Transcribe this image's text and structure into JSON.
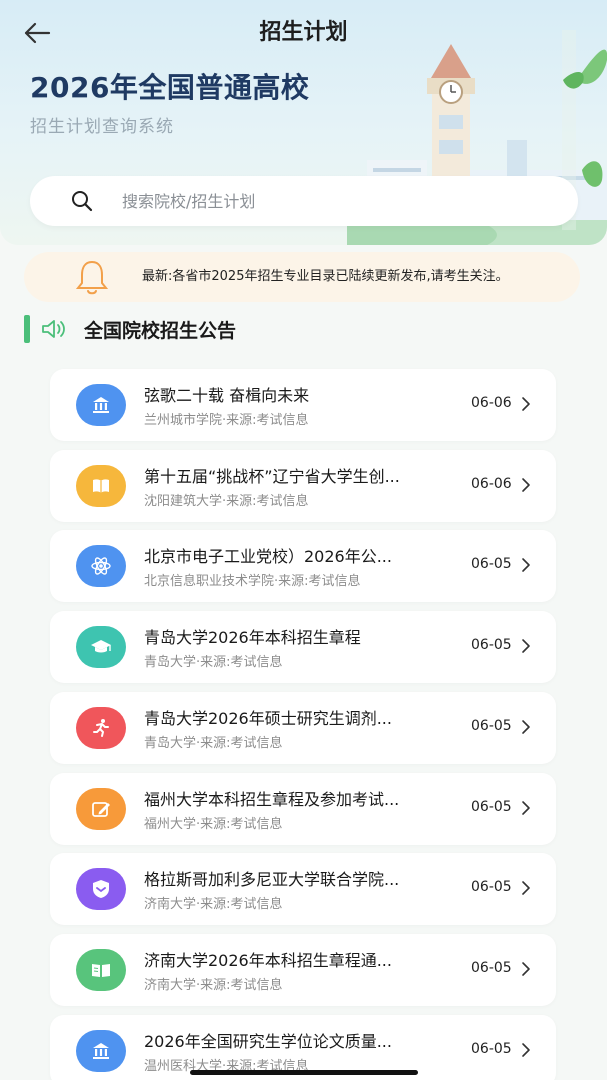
{
  "header": {
    "title": "招生计划",
    "hero_title": "2026年全国普通高校",
    "hero_subtitle": "招生计划查询系统"
  },
  "search": {
    "placeholder": "搜索院校/招生计划"
  },
  "notice": {
    "text": "最新:各省市2025年招生专业目录已陆续更新发布,请考生关注。"
  },
  "section": {
    "title": "全国院校招生公告"
  },
  "colors": {
    "accent_green": "#4bbf7a",
    "icon_blue": "#4f93f0",
    "icon_yellow": "#f6b73c",
    "icon_teal": "#3ec4b0",
    "icon_red": "#f0565b",
    "icon_orange": "#f79a3a",
    "icon_purple": "#8a5cf0",
    "icon_green": "#58c47c"
  },
  "announcements": [
    {
      "title": "弦歌二十载 奋楫向未来",
      "meta": "兰州城市学院·来源:考试信息",
      "date": "06-06",
      "icon": "institution-icon",
      "color": "#4f93f0"
    },
    {
      "title": "第十五届“挑战杯”辽宁省大学生创...",
      "meta": "沈阳建筑大学·来源:考试信息",
      "date": "06-06",
      "icon": "book-icon",
      "color": "#f6b73c"
    },
    {
      "title": "北京市电子工业党校）2026年公...",
      "meta": "北京信息职业技术学院·来源:考试信息",
      "date": "06-05",
      "icon": "atom-icon",
      "color": "#4f93f0"
    },
    {
      "title": "青岛大学2026年本科招生章程",
      "meta": "青岛大学·来源:考试信息",
      "date": "06-05",
      "icon": "graduation-cap-icon",
      "color": "#3ec4b0"
    },
    {
      "title": "青岛大学2026年硕士研究生调剂...",
      "meta": "青岛大学·来源:考试信息",
      "date": "06-05",
      "icon": "runner-icon",
      "color": "#f0565b"
    },
    {
      "title": "福州大学本科招生章程及参加考试...",
      "meta": "福州大学·来源:考试信息",
      "date": "06-05",
      "icon": "edit-icon",
      "color": "#f79a3a"
    },
    {
      "title": "格拉斯哥加利多尼亚大学联合学院...",
      "meta": "济南大学·来源:考试信息",
      "date": "06-05",
      "icon": "shield-icon",
      "color": "#8a5cf0"
    },
    {
      "title": "济南大学2026年本科招生章程通...",
      "meta": "济南大学·来源:考试信息",
      "date": "06-05",
      "icon": "open-book-icon",
      "color": "#58c47c"
    },
    {
      "title": "2026年全国研究生学位论文质量...",
      "meta": "温州医科大学·来源:考试信息",
      "date": "06-05",
      "icon": "institution-icon",
      "color": "#4f93f0"
    }
  ]
}
